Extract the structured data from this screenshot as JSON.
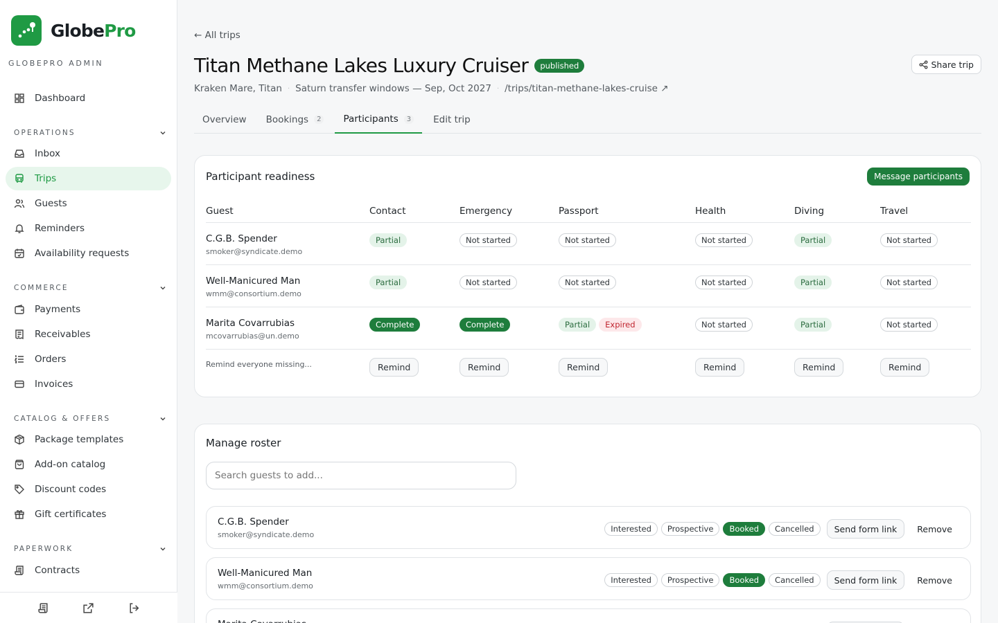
{
  "brand": {
    "name_a": "Globe",
    "name_b": "Pro",
    "admin_label": "GLOBEPRO ADMIN",
    "accent": "#1f9a44"
  },
  "sidebar": {
    "dashboard": "Dashboard",
    "sections": [
      {
        "title": "OPERATIONS",
        "items": [
          "Inbox",
          "Trips",
          "Guests",
          "Reminders",
          "Availability requests"
        ]
      },
      {
        "title": "COMMERCE",
        "items": [
          "Payments",
          "Receivables",
          "Orders",
          "Invoices"
        ]
      },
      {
        "title": "CATALOG & OFFERS",
        "items": [
          "Package templates",
          "Add-on catalog",
          "Discount codes",
          "Gift certificates"
        ]
      },
      {
        "title": "PAPERWORK",
        "items": [
          "Contracts"
        ]
      }
    ],
    "active": "Trips",
    "footer_icons": [
      "contracts-icon",
      "external-link-icon",
      "logout-icon"
    ]
  },
  "trip": {
    "back": "← All trips",
    "title": "Titan Methane Lakes Luxury Cruiser",
    "status": "published",
    "location": "Kraken Mare, Titan",
    "windows": "Saturn transfer windows — Sep, Oct 2027",
    "path": "/trips/titan-methane-lakes-cruise ↗",
    "share": "Share trip"
  },
  "tabs": [
    {
      "label": "Overview",
      "count": ""
    },
    {
      "label": "Bookings",
      "count": "2"
    },
    {
      "label": "Participants",
      "count": "3"
    },
    {
      "label": "Edit trip",
      "count": ""
    }
  ],
  "readiness": {
    "title": "Participant readiness",
    "message_btn": "Message participants",
    "columns": [
      "Guest",
      "Contact",
      "Emergency",
      "Passport",
      "Health",
      "Diving",
      "Travel"
    ],
    "rows": [
      {
        "name": "C.G.B. Spender",
        "email": "smoker@syndicate.demo",
        "cells": [
          [
            {
              "t": "Partial",
              "k": "partial"
            }
          ],
          [
            {
              "t": "Not started",
              "k": "ns"
            }
          ],
          [
            {
              "t": "Not started",
              "k": "ns"
            }
          ],
          [
            {
              "t": "Not started",
              "k": "ns"
            }
          ],
          [
            {
              "t": "Partial",
              "k": "partial"
            }
          ],
          [
            {
              "t": "Not started",
              "k": "ns"
            }
          ]
        ]
      },
      {
        "name": "Well-Manicured Man",
        "email": "wmm@consortium.demo",
        "cells": [
          [
            {
              "t": "Partial",
              "k": "partial"
            }
          ],
          [
            {
              "t": "Not started",
              "k": "ns"
            }
          ],
          [
            {
              "t": "Not started",
              "k": "ns"
            }
          ],
          [
            {
              "t": "Not started",
              "k": "ns"
            }
          ],
          [
            {
              "t": "Partial",
              "k": "partial"
            }
          ],
          [
            {
              "t": "Not started",
              "k": "ns"
            }
          ]
        ]
      },
      {
        "name": "Marita Covarrubias",
        "email": "mcovarrubias@un.demo",
        "cells": [
          [
            {
              "t": "Complete",
              "k": "complete"
            }
          ],
          [
            {
              "t": "Complete",
              "k": "complete"
            }
          ],
          [
            {
              "t": "Partial",
              "k": "partial"
            },
            {
              "t": "Expired",
              "k": "expired"
            }
          ],
          [
            {
              "t": "Not started",
              "k": "ns"
            }
          ],
          [
            {
              "t": "Partial",
              "k": "partial"
            }
          ],
          [
            {
              "t": "Not started",
              "k": "ns"
            }
          ]
        ]
      }
    ],
    "remind_hint": "Remind everyone missing...",
    "remind_label": "Remind"
  },
  "roster": {
    "title": "Manage roster",
    "search_placeholder": "Search guests to add...",
    "statuses": [
      "Interested",
      "Prospective",
      "Booked",
      "Cancelled"
    ],
    "send_label": "Send form link",
    "remove_label": "Remove",
    "guests": [
      {
        "name": "C.G.B. Spender",
        "email": "smoker@syndicate.demo",
        "status": "Booked"
      },
      {
        "name": "Well-Manicured Man",
        "email": "wmm@consortium.demo",
        "status": "Booked"
      },
      {
        "name": "Marita Covarrubias",
        "email": "",
        "status": ""
      }
    ]
  }
}
